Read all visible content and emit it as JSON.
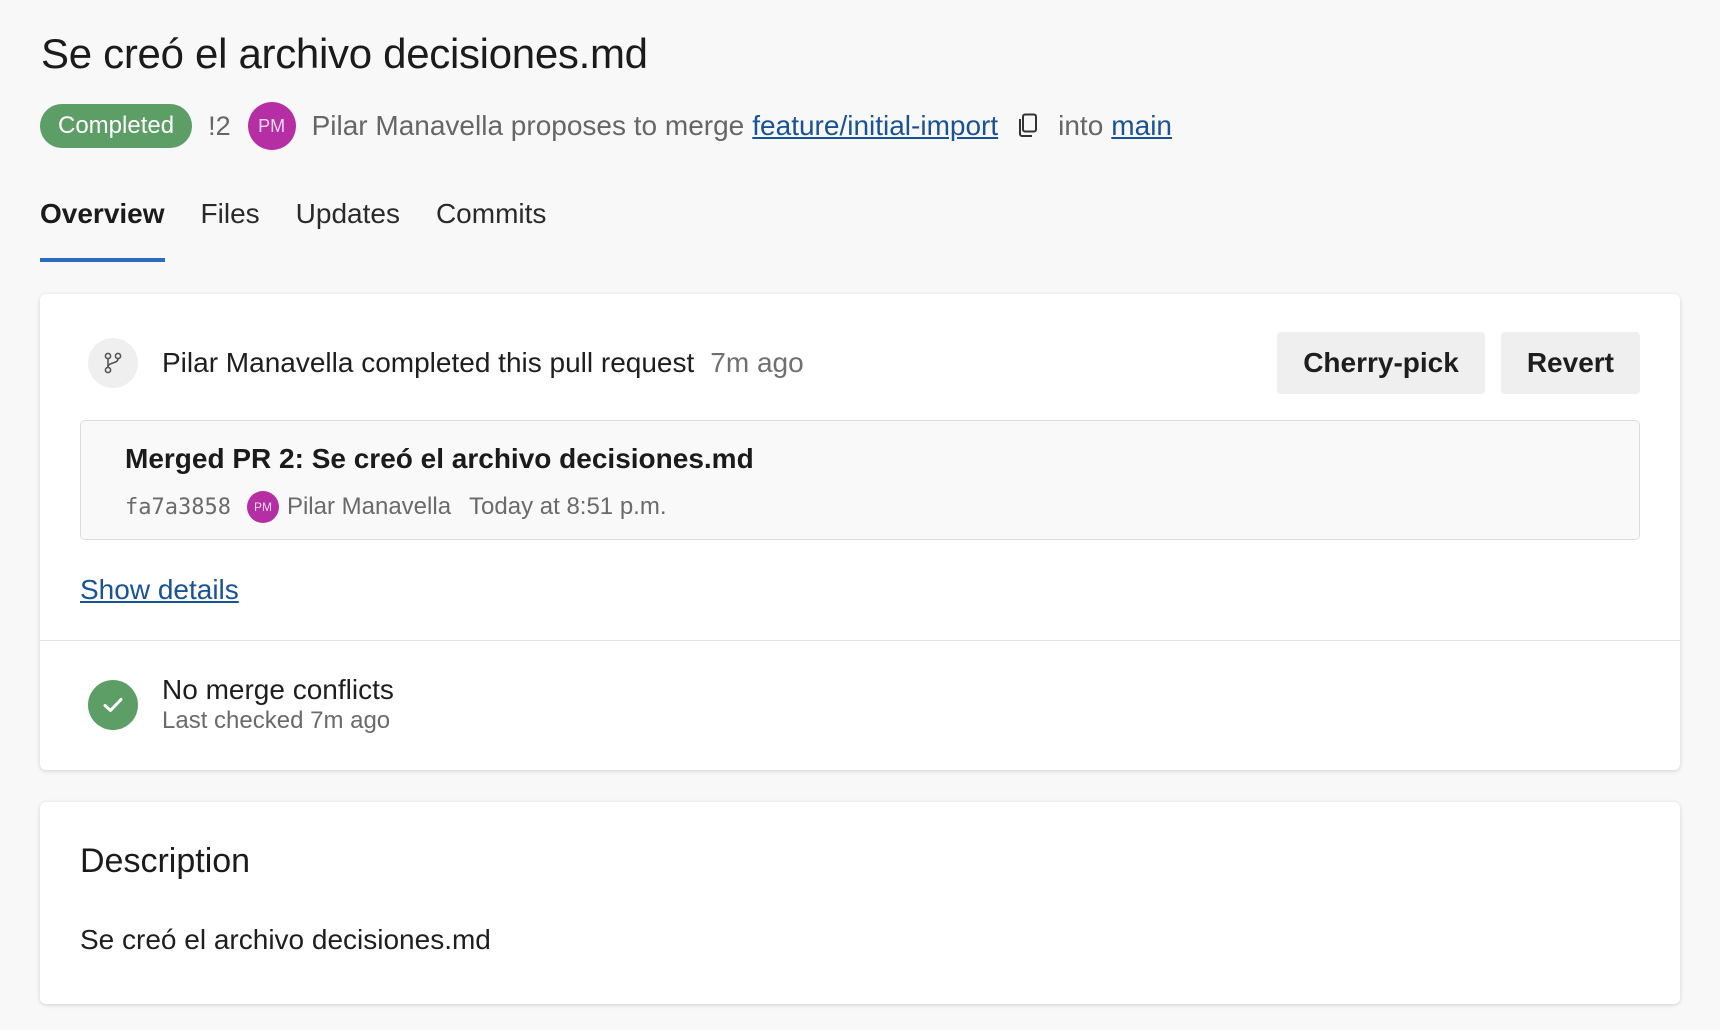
{
  "header": {
    "title": "Se creó el archivo decisiones.md",
    "status_badge": "Completed",
    "pr_id": "!2",
    "author_initials": "PM",
    "proposal_text": "Pilar Manavella proposes to merge",
    "source_branch": "feature/initial-import",
    "into_text": "into",
    "target_branch": "main"
  },
  "tabs": [
    {
      "label": "Overview",
      "active": true
    },
    {
      "label": "Files",
      "active": false
    },
    {
      "label": "Updates",
      "active": false
    },
    {
      "label": "Commits",
      "active": false
    }
  ],
  "activity": {
    "text": "Pilar Manavella completed this pull request",
    "time": "7m ago",
    "cherry_pick_label": "Cherry-pick",
    "revert_label": "Revert"
  },
  "commit": {
    "title": "Merged PR 2: Se creó el archivo decisiones.md",
    "hash": "fa7a3858",
    "author_initials": "PM",
    "author": "Pilar Manavella",
    "date": "Today at 8:51 p.m."
  },
  "show_details_label": "Show details",
  "merge_status": {
    "title": "No merge conflicts",
    "subtitle": "Last checked 7m ago"
  },
  "description": {
    "heading": "Description",
    "body": "Se creó el archivo decisiones.md"
  },
  "colors": {
    "completed_badge": "#5c9e65",
    "avatar": "#b62ea3",
    "link": "#1a5296",
    "active_tab_underline": "#2b6bc0"
  },
  "icons": [
    "copy-icon",
    "merge-icon",
    "check-icon"
  ]
}
